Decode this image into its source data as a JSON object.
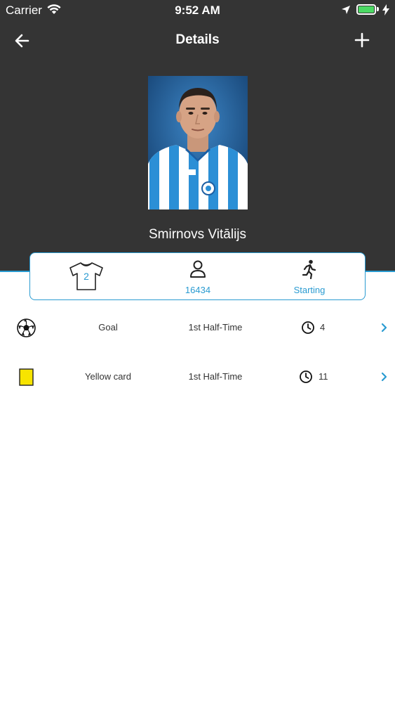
{
  "status_bar": {
    "carrier": "Carrier",
    "time": "9:52 AM",
    "battery_level": 1.0
  },
  "nav": {
    "title": "Details",
    "back_icon": "arrow-left-icon",
    "add_icon": "plus-icon"
  },
  "player": {
    "name": "Smirnovs Vitālijs",
    "shirt_number": "2",
    "id_number": "16434",
    "status": "Starting"
  },
  "events": [
    {
      "icon": "soccer-ball-icon",
      "type": "Goal",
      "period": "1st Half-Time",
      "minute": "4"
    },
    {
      "icon": "yellow-card-icon",
      "type": "Yellow card",
      "period": "1st Half-Time",
      "minute": "11"
    }
  ],
  "colors": {
    "header_bg": "#343434",
    "accent": "#2a9bd1",
    "yellow_card": "#f7e400",
    "battery": "#4cd964"
  }
}
